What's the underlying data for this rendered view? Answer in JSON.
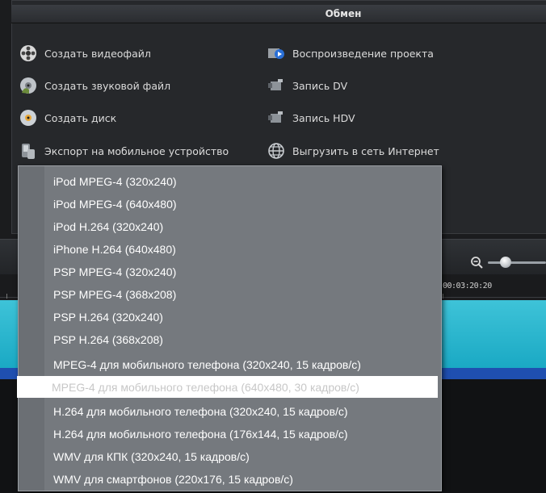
{
  "panel": {
    "title": "Обмен",
    "options_left": [
      {
        "label": "Создать видеофайл",
        "icon": "film-reel-icon"
      },
      {
        "label": "Создать звуковой файл",
        "icon": "audio-disc-icon"
      },
      {
        "label": "Создать диск",
        "icon": "disc-icon"
      },
      {
        "label": "Экспорт на мобильное устройство",
        "icon": "mobile-device-icon"
      }
    ],
    "options_right": [
      {
        "label": "Воспроизведение проекта",
        "icon": "project-playback-icon"
      },
      {
        "label": "Запись DV",
        "icon": "camcorder-icon"
      },
      {
        "label": "Запись HDV",
        "icon": "camcorder-icon"
      },
      {
        "label": "Выгрузить в сеть Интернет",
        "icon": "globe-icon"
      }
    ]
  },
  "timeline": {
    "timecode": "00:03:20:20",
    "zoom_icon": "zoom-out-icon"
  },
  "menu": {
    "items": [
      "iPod MPEG-4  (320x240)",
      "iPod MPEG-4  (640x480)",
      "iPod H.264 (320x240)",
      "iPhone H.264 (640x480)",
      "PSP MPEG-4  (320x240)",
      "PSP MPEG-4  (368x208)",
      "PSP H.264  (320x240)",
      "PSP H.264  (368x208)",
      "MPEG-4 для мобильного телефона (320x240, 15 кадров/с)",
      "MPEG-4 для мобильного телефона (640x480, 30 кадров/с)",
      "H.264 для мобильного телефона (320x240, 15 кадров/с)",
      "H.264 для мобильного телефона (176x144, 15 кадров/с)",
      "WMV для КПК (320x240, 15 кадров/с)",
      "WMV для смартфонов (220x176, 15 кадров/с)"
    ],
    "highlighted_index": 9
  }
}
